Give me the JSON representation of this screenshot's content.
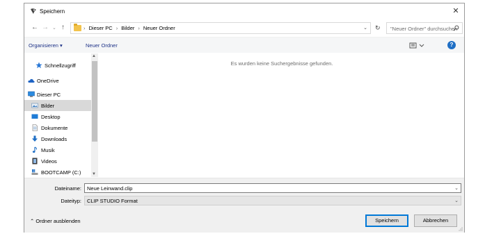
{
  "window": {
    "title": "Speichern"
  },
  "nav_buttons": {
    "back": "←",
    "forward": "→",
    "recent": "⌄",
    "up": "↑"
  },
  "address": {
    "crumbs": [
      "Dieser PC",
      "Bilder",
      "Neuer Ordner"
    ],
    "separator": "›"
  },
  "search": {
    "placeholder": "\"Neuer Ordner\" durchsuchen"
  },
  "toolbar": {
    "organize_label": "Organisieren ▾",
    "new_folder_label": "Neuer Ordner",
    "help_label": "?"
  },
  "sidebar": {
    "items": [
      {
        "label": "Schnellzugriff",
        "icon": "star-icon"
      },
      {
        "label": "OneDrive",
        "icon": "cloud-icon"
      },
      {
        "label": "Dieser PC",
        "icon": "computer-icon"
      },
      {
        "label": "Bilder",
        "icon": "pictures-icon",
        "selected": true
      },
      {
        "label": "Desktop",
        "icon": "desktop-icon"
      },
      {
        "label": "Dokumente",
        "icon": "documents-icon"
      },
      {
        "label": "Downloads",
        "icon": "download-icon"
      },
      {
        "label": "Musik",
        "icon": "music-icon"
      },
      {
        "label": "Videos",
        "icon": "video-icon"
      },
      {
        "label": "BOOTCAMP (C:)",
        "icon": "drive-icon"
      }
    ]
  },
  "content": {
    "empty_message": "Es wurden keine Suchergebnisse gefunden."
  },
  "form": {
    "filename_label": "Dateiname:",
    "filename_value": "Neue Leinwand.clip",
    "filetype_label": "Dateityp:",
    "filetype_value": "CLIP STUDIO Format"
  },
  "footer": {
    "hide_folders_label": "Ordner ausblenden",
    "save_label": "Speichern",
    "cancel_label": "Abbrechen"
  },
  "colors": {
    "accent": "#0078d7",
    "link": "#1e3287",
    "selection": "#d9d9d9",
    "folder": "#f2c34c"
  }
}
